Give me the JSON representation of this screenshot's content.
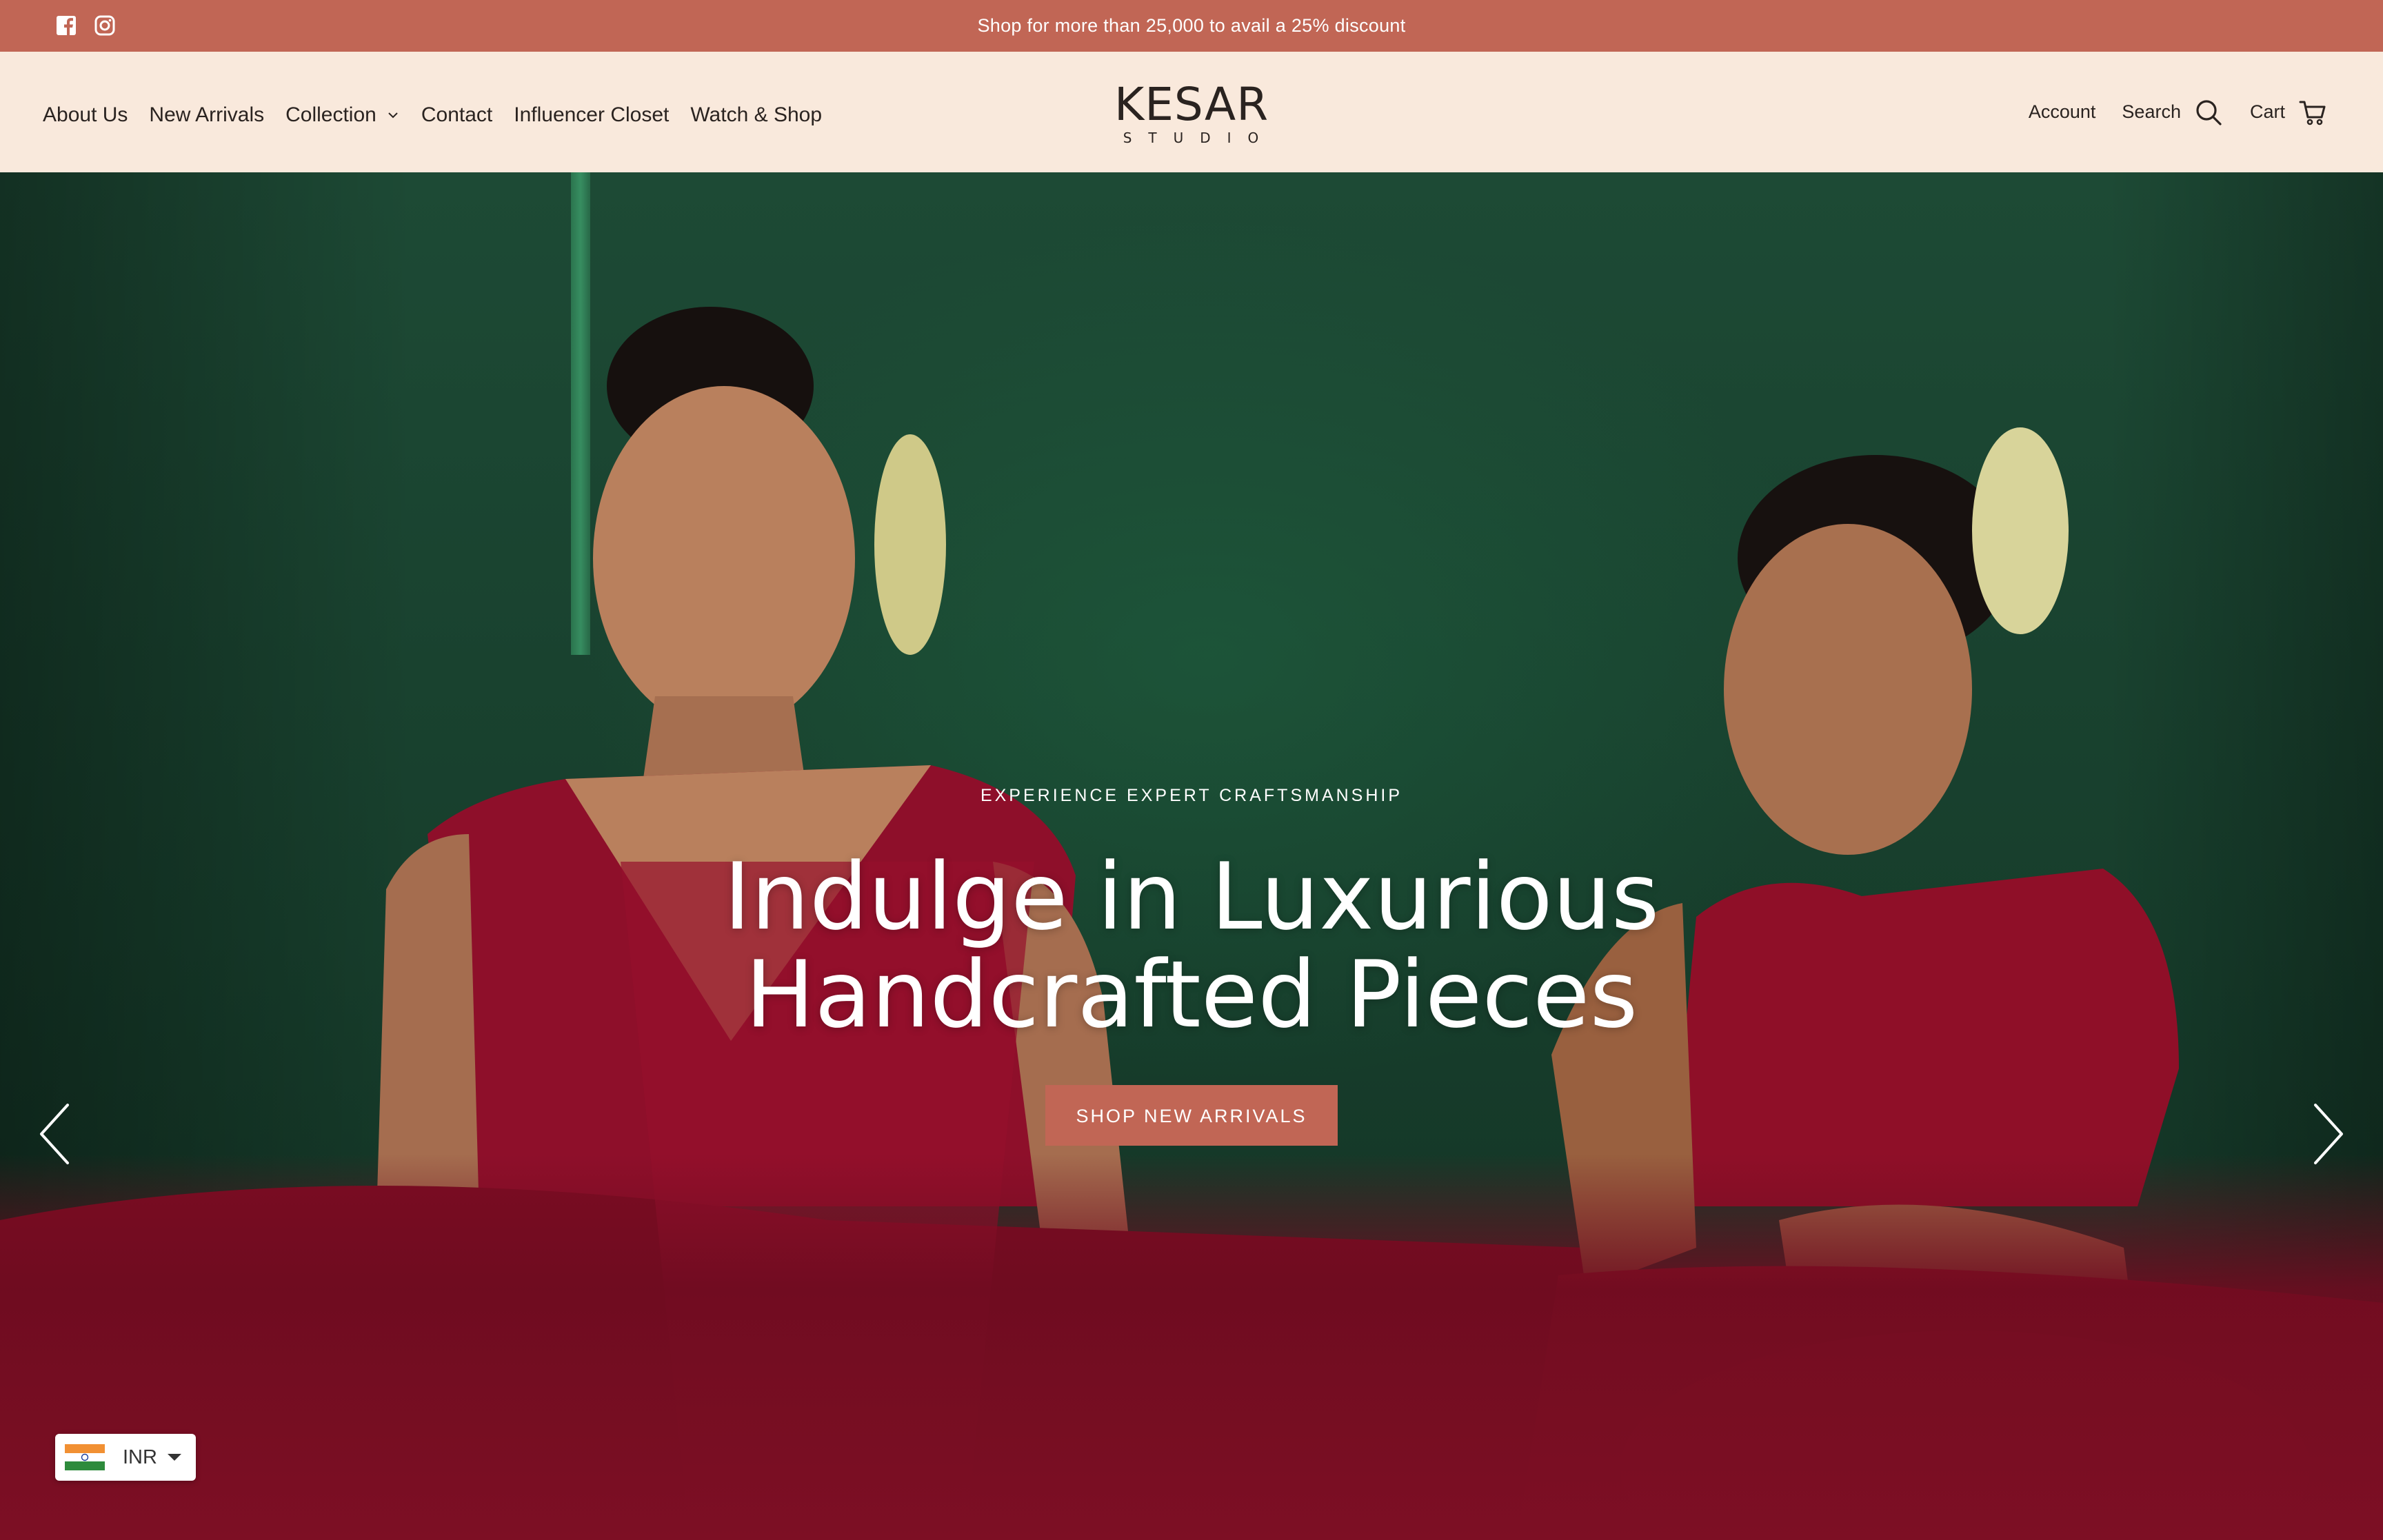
{
  "announcement": {
    "message": "Shop for more than 25,000 to avail a 25% discount",
    "social_icons": [
      "facebook-icon",
      "instagram-icon"
    ]
  },
  "header": {
    "nav": [
      {
        "label": "About Us"
      },
      {
        "label": "New Arrivals"
      },
      {
        "label": "Collection",
        "has_dropdown": true
      },
      {
        "label": "Contact"
      },
      {
        "label": "Influencer Closet"
      },
      {
        "label": "Watch & Shop"
      }
    ],
    "logo": {
      "line1": "KESAR",
      "line2": "STUDIO"
    },
    "account_label": "Account",
    "search_label": "Search",
    "cart_label": "Cart"
  },
  "hero": {
    "eyebrow": "EXPERIENCE EXPERT CRAFTSMANSHIP",
    "headline_line1": "Indulge in Luxurious",
    "headline_line2": "Handcrafted Pieces",
    "cta_label": "SHOP NEW ARRIVALS"
  },
  "currency": {
    "code": "INR",
    "flag": "india-flag-icon"
  },
  "colors": {
    "accent": "#c16655",
    "header_bg": "#f9e9dc",
    "hero_green": "#1d4a35",
    "garment_red": "#8e0f2a"
  }
}
